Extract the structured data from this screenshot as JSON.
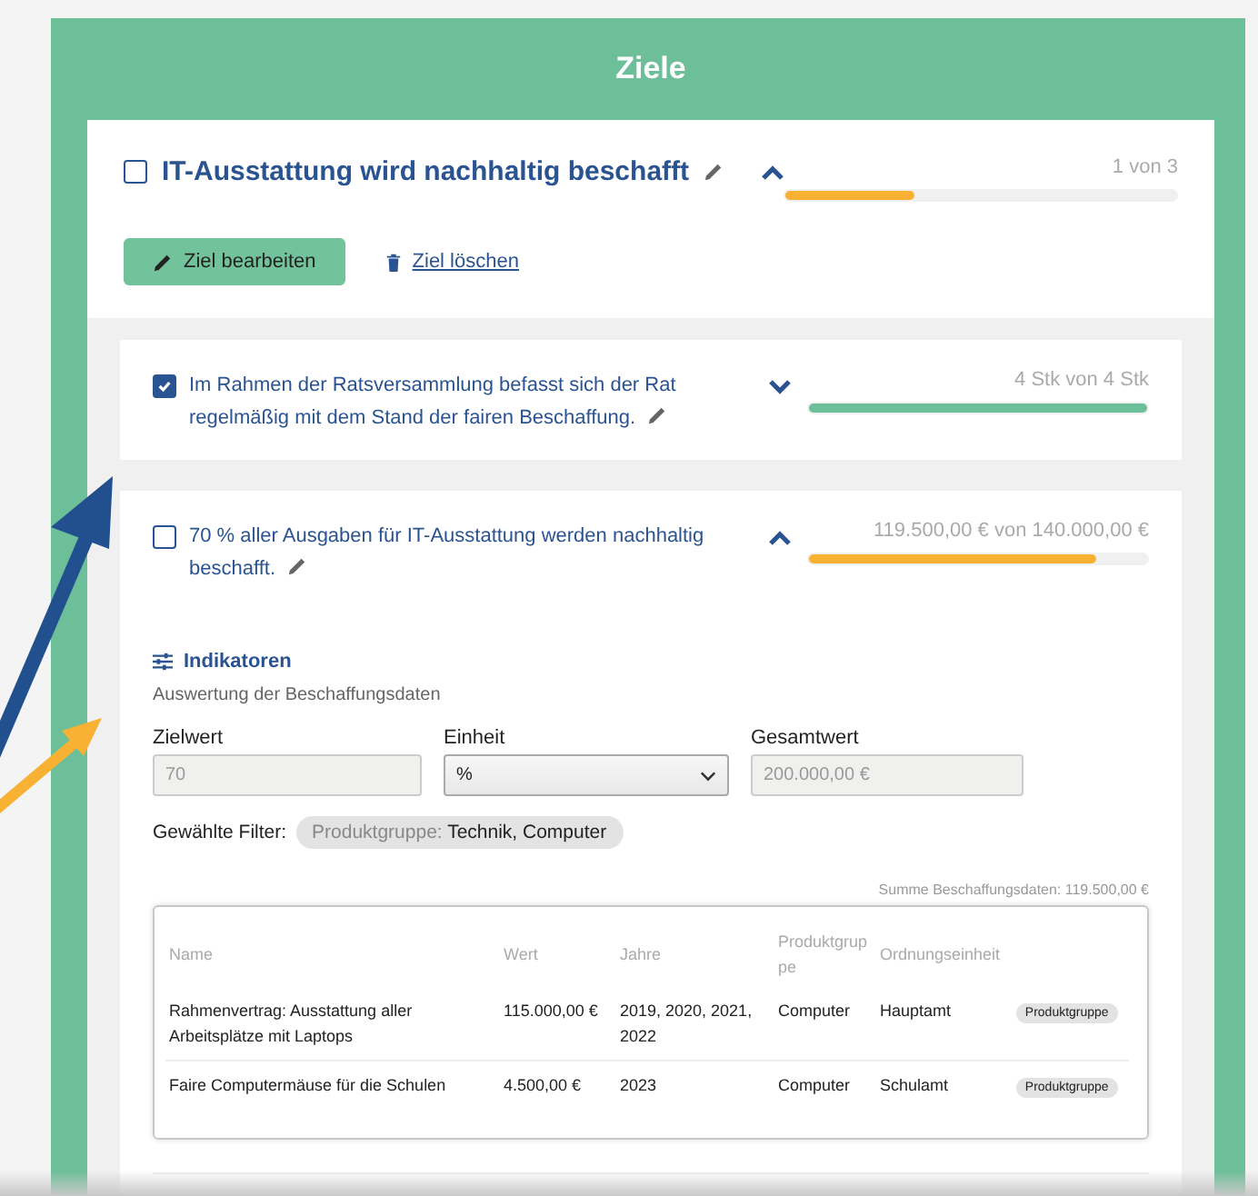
{
  "header": {
    "title": "Ziele"
  },
  "goal": {
    "title": "IT-Ausstattung wird nachhaltig beschafft",
    "checked": false,
    "expanded": true,
    "progress": "1 von 3",
    "level": 0.33,
    "color": "#f8b133"
  },
  "actions": {
    "edit": "Ziel bearbeiten",
    "delete": "Ziel löschen"
  },
  "subgoals": [
    {
      "title": "Im Rahmen der Ratsversammlung befasst sich der Rat regelmäßig mit dem Stand der fairen Beschaffung.",
      "checked": true,
      "expanded": false,
      "progress": "4 Stk von 4 Stk",
      "level": 1,
      "color": "#6dbf99"
    },
    {
      "title": "70 % aller Ausgaben für IT-Ausstattung werden nachhaltig beschafft.",
      "checked": false,
      "expanded": true,
      "progress": "119.500,00 € von 140.000,00 €",
      "level": 0.85,
      "color": "#f8b133"
    }
  ],
  "indicator": {
    "title": "Indikatoren",
    "subtitle": "Auswertung der Beschaffungsdaten",
    "fields": [
      {
        "label": "Zielwert",
        "kind": "input",
        "value": "70"
      },
      {
        "label": "Einheit",
        "kind": "select",
        "value": "%"
      },
      {
        "label": "Gesamtwert",
        "kind": "input",
        "value": "200.000,00 €"
      }
    ],
    "filter_label": "Gewählte Filter:",
    "filter_key": "Produktgruppe:",
    "filter_value": "Technik, Computer",
    "sum": "Summe Beschaffungsdaten: 119.500,00 €"
  },
  "table": {
    "columns": [
      "Name",
      "Wert",
      "Jahre",
      "Produktgruppe",
      "Ordnungseinheit"
    ],
    "rows": [
      {
        "cells": [
          "Rahmenvertrag: Ausstattung aller Arbeitsplätze mit Laptops",
          "115.000,00 €",
          "2019, 2020, 2021, 2022",
          "Computer",
          "Hauptamt"
        ],
        "tag": "Produktgruppe"
      },
      {
        "cells": [
          "Faire Computermäuse für die Schulen",
          "4.500,00 €",
          "2023",
          "Computer",
          "Schulamt"
        ],
        "tag": "Produktgruppe"
      }
    ]
  }
}
